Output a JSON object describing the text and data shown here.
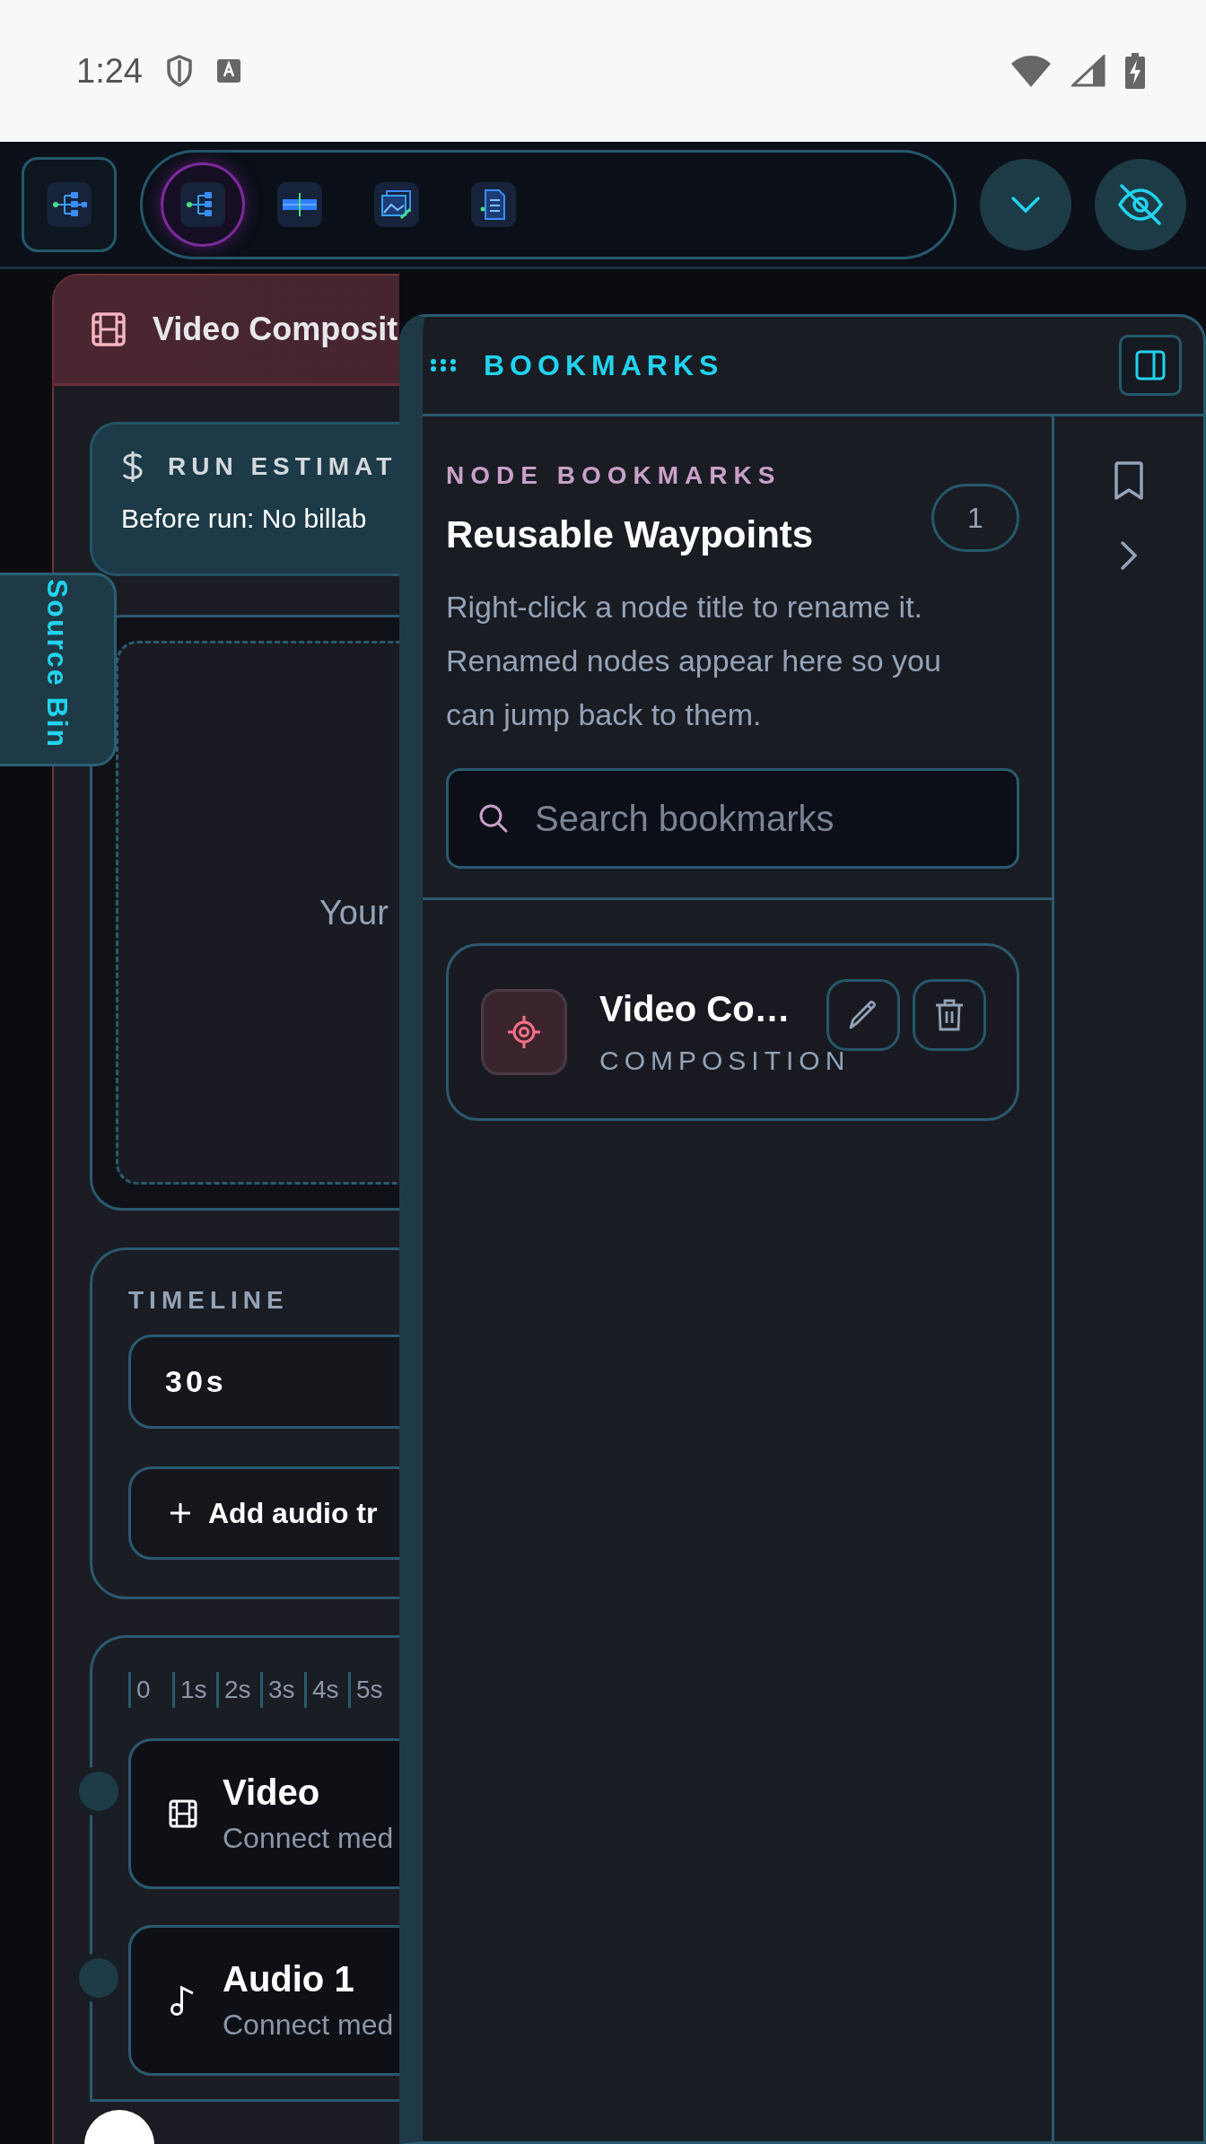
{
  "status_bar": {
    "time": "1:24"
  },
  "toolbar": {
    "tabs": [
      {
        "kind": "workflow",
        "selected": true
      },
      {
        "kind": "timeline",
        "selected": false
      },
      {
        "kind": "gallery",
        "selected": false
      },
      {
        "kind": "document",
        "selected": false
      }
    ]
  },
  "node": {
    "title": "Video Composit",
    "run_estimate": {
      "label": "RUN ESTIMAT",
      "text": "Before run: No billab"
    },
    "preview_text": "Your",
    "timeline": {
      "label": "TIMELINE",
      "duration": "30s",
      "add_button": "Add audio tr"
    },
    "ruler": [
      "0",
      "1s",
      "2s",
      "3s",
      "4s",
      "5s"
    ],
    "tracks": [
      {
        "kind": "video",
        "name": "Video",
        "hint": "Connect med"
      },
      {
        "kind": "audio",
        "name": "Audio 1",
        "hint": "Connect med"
      }
    ]
  },
  "source_bin": {
    "label": "Source Bin"
  },
  "bookmarks_panel": {
    "title": "BOOKMARKS",
    "eyebrow": "NODE BOOKMARKS",
    "heading": "Reusable Waypoints",
    "count": "1",
    "description": "Right-click a node title to rename it. Renamed nodes appear here so you can jump back to them.",
    "search": {
      "placeholder": "Search bookmarks"
    },
    "items": [
      {
        "title": "Video Co…",
        "type": "COMPOSITION"
      }
    ]
  }
}
